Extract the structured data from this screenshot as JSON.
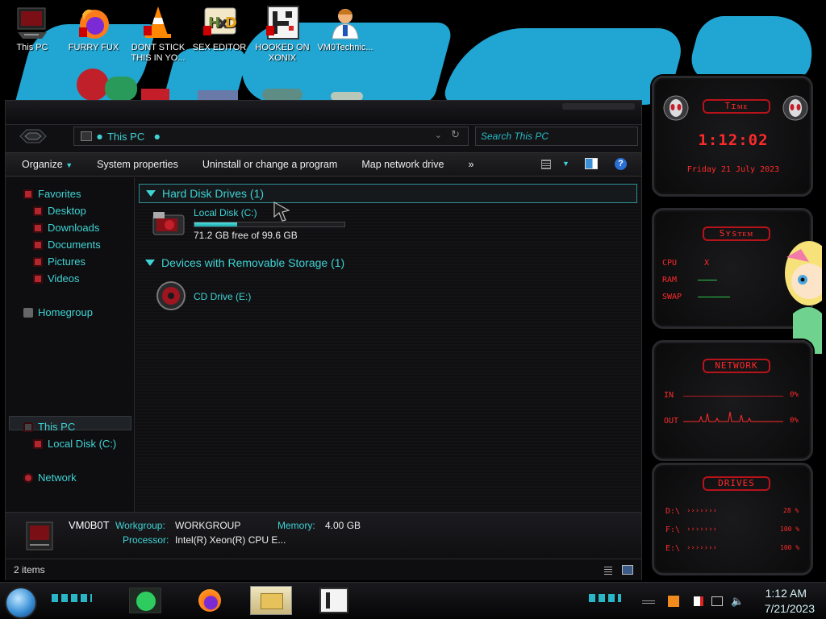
{
  "desktop": {
    "icons": [
      {
        "label": "This PC"
      },
      {
        "label": "FURRY FUX"
      },
      {
        "label": "DONT STICK THIS IN YO..."
      },
      {
        "label": "SEX EDITOR"
      },
      {
        "label": "HOOKED ON XONIX"
      },
      {
        "label": "VM0Technic..."
      }
    ]
  },
  "explorer": {
    "address": "This PC",
    "search_placeholder": "Search This PC",
    "toolbar": {
      "organize": "Organize",
      "system_properties": "System properties",
      "uninstall": "Uninstall or change a program",
      "map_drive": "Map network drive",
      "more": "»"
    },
    "nav": {
      "favorites": "Favorites",
      "desktop": "Desktop",
      "downloads": "Downloads",
      "documents": "Documents",
      "pictures": "Pictures",
      "videos": "Videos",
      "homegroup": "Homegroup",
      "this_pc": "This PC",
      "local_disk": "Local Disk (C:)",
      "network": "Network"
    },
    "groups": {
      "hdd": "Hard Disk Drives (1)",
      "removable": "Devices with Removable Storage (1)"
    },
    "drives": {
      "c_name": "Local Disk (C:)",
      "c_free": "71.2 GB free of 99.6 GB",
      "c_used_fraction": 0.285,
      "e_name": "CD Drive (E:)"
    },
    "details": {
      "computer": "VM0B0T",
      "workgroup_label": "Workgroup:",
      "workgroup": "WORKGROUP",
      "memory_label": "Memory:",
      "memory": "4.00 GB",
      "processor_label": "Processor:",
      "processor": "Intel(R) Xeon(R) CPU E..."
    },
    "status": "2 items"
  },
  "gadgets": {
    "time": {
      "title": "Tɪᴍᴇ",
      "clock": "1:12:02",
      "date": "Friday 21 July 2023"
    },
    "system": {
      "title": "Sʏsᴛᴇᴍ",
      "cpu": "CPU",
      "cpu_val": "X",
      "ram": "RAM",
      "swap": "SWAP"
    },
    "network": {
      "title": "NETWORK",
      "in": "IN",
      "in_val": "0%",
      "out": "OUT",
      "out_val": "0%"
    },
    "drives": {
      "title": "DRIVES",
      "d1": "D:\\",
      "d1_val": "28 %",
      "d2": "F:\\",
      "d2_val": "100 %",
      "d3": "E:\\",
      "d3_val": "100 %"
    }
  },
  "taskbar": {
    "time": "1:12 AM",
    "date": "7/21/2023"
  },
  "colors": {
    "accent": "#3fd3d5",
    "red": "#ff2a2a",
    "paint": "#21a6d3"
  }
}
